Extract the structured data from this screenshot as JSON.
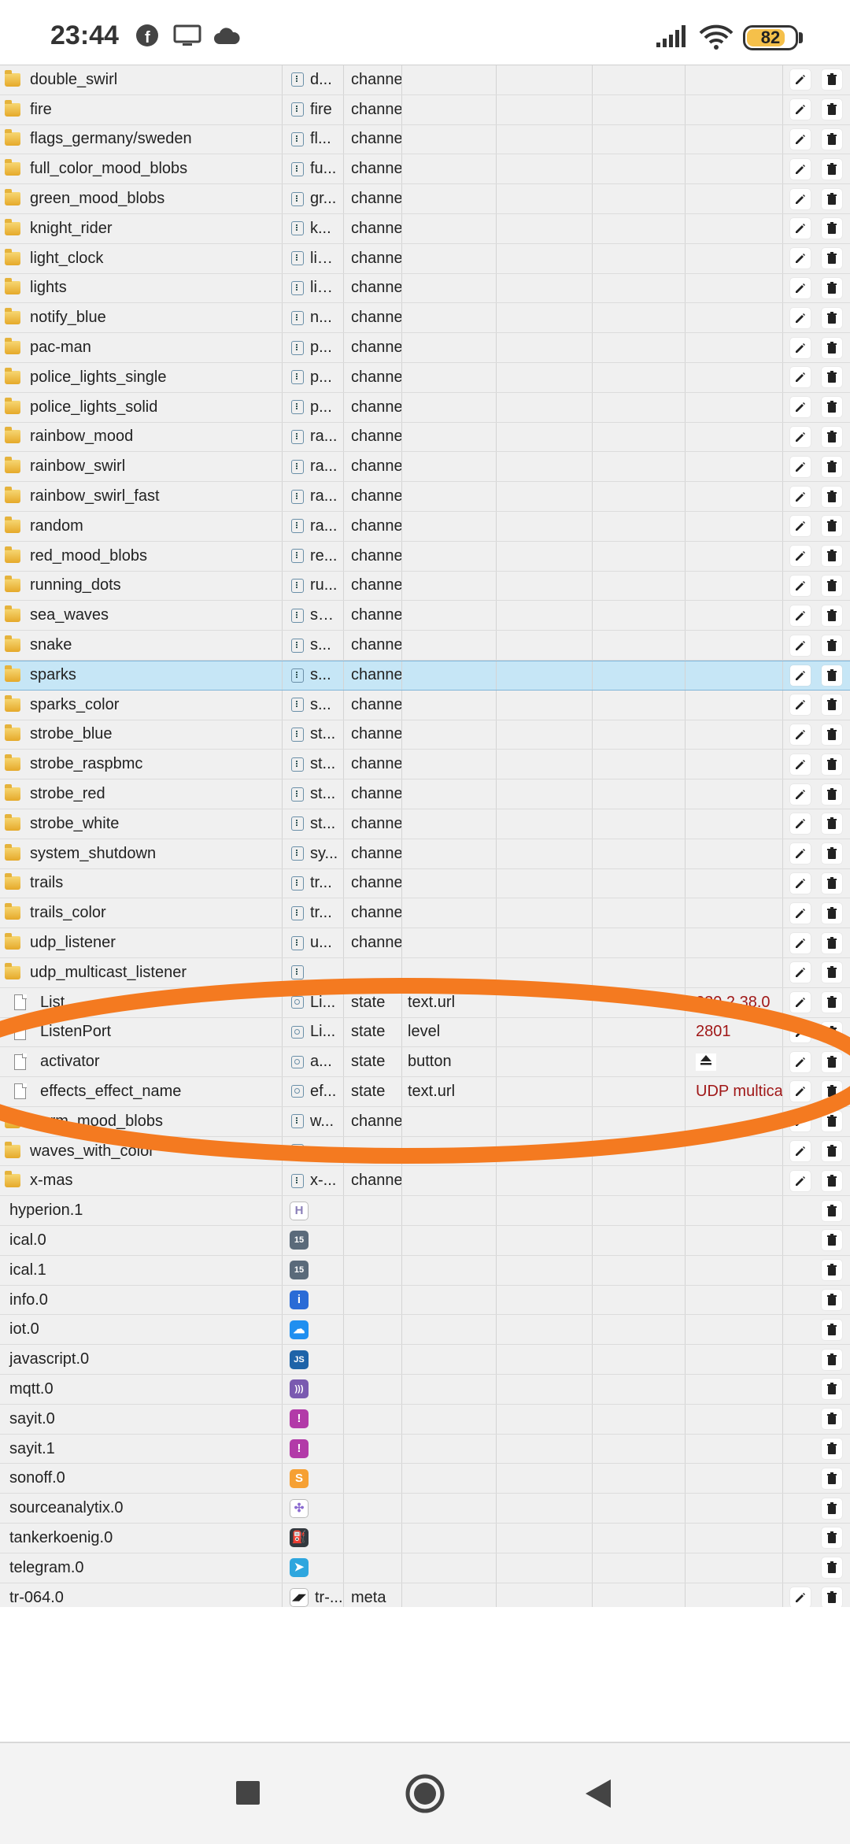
{
  "status_bar": {
    "time": "23:44",
    "icons": [
      "facebook-icon",
      "screen-cast-icon",
      "cloud-icon"
    ],
    "right_icons": [
      "signal-icon",
      "wifi-icon"
    ],
    "battery": "82",
    "battery_level": 0.82
  },
  "rows": [
    {
      "kind": "folder",
      "name": "double_swirl",
      "icon": "obj",
      "type": "d...",
      "role": "channe"
    },
    {
      "kind": "folder",
      "name": "fire",
      "icon": "obj",
      "type": "fire",
      "role": "channe"
    },
    {
      "kind": "folder",
      "name": "flags_germany/sweden",
      "icon": "obj",
      "type": "fl...",
      "role": "channe"
    },
    {
      "kind": "folder",
      "name": "full_color_mood_blobs",
      "icon": "obj",
      "type": "fu...",
      "role": "channe"
    },
    {
      "kind": "folder",
      "name": "green_mood_blobs",
      "icon": "obj",
      "type": "gr...",
      "role": "channe"
    },
    {
      "kind": "folder",
      "name": "knight_rider",
      "icon": "obj",
      "type": "k...",
      "role": "channe"
    },
    {
      "kind": "folder",
      "name": "light_clock",
      "icon": "obj",
      "type": "lig...",
      "role": "channe"
    },
    {
      "kind": "folder",
      "name": "lights",
      "icon": "obj",
      "type": "lig...",
      "role": "channe"
    },
    {
      "kind": "folder",
      "name": "notify_blue",
      "icon": "obj",
      "type": "n...",
      "role": "channe"
    },
    {
      "kind": "folder",
      "name": "pac-man",
      "icon": "obj",
      "type": "p...",
      "role": "channe"
    },
    {
      "kind": "folder",
      "name": "police_lights_single",
      "icon": "obj",
      "type": "p...",
      "role": "channe"
    },
    {
      "kind": "folder",
      "name": "police_lights_solid",
      "icon": "obj",
      "type": "p...",
      "role": "channe"
    },
    {
      "kind": "folder",
      "name": "rainbow_mood",
      "icon": "obj",
      "type": "ra...",
      "role": "channe"
    },
    {
      "kind": "folder",
      "name": "rainbow_swirl",
      "icon": "obj",
      "type": "ra...",
      "role": "channe"
    },
    {
      "kind": "folder",
      "name": "rainbow_swirl_fast",
      "icon": "obj",
      "type": "ra...",
      "role": "channe"
    },
    {
      "kind": "folder",
      "name": "random",
      "icon": "obj",
      "type": "ra...",
      "role": "channe"
    },
    {
      "kind": "folder",
      "name": "red_mood_blobs",
      "icon": "obj",
      "type": "re...",
      "role": "channe"
    },
    {
      "kind": "folder",
      "name": "running_dots",
      "icon": "obj",
      "type": "ru...",
      "role": "channe"
    },
    {
      "kind": "folder",
      "name": "sea_waves",
      "icon": "obj",
      "type": "se...",
      "role": "channe"
    },
    {
      "kind": "folder",
      "name": "snake",
      "icon": "obj",
      "type": "s...",
      "role": "channe"
    },
    {
      "kind": "folder",
      "name": "sparks",
      "icon": "obj",
      "type": "s...",
      "role": "channe",
      "selected": true
    },
    {
      "kind": "folder",
      "name": "sparks_color",
      "icon": "obj",
      "type": "s...",
      "role": "channe"
    },
    {
      "kind": "folder",
      "name": "strobe_blue",
      "icon": "obj",
      "type": "st...",
      "role": "channe"
    },
    {
      "kind": "folder",
      "name": "strobe_raspbmc",
      "icon": "obj",
      "type": "st...",
      "role": "channe"
    },
    {
      "kind": "folder",
      "name": "strobe_red",
      "icon": "obj",
      "type": "st...",
      "role": "channe"
    },
    {
      "kind": "folder",
      "name": "strobe_white",
      "icon": "obj",
      "type": "st...",
      "role": "channe"
    },
    {
      "kind": "folder",
      "name": "system_shutdown",
      "icon": "obj",
      "type": "sy...",
      "role": "channe"
    },
    {
      "kind": "folder",
      "name": "trails",
      "icon": "obj",
      "type": "tr...",
      "role": "channe"
    },
    {
      "kind": "folder",
      "name": "trails_color",
      "icon": "obj",
      "type": "tr...",
      "role": "channe"
    },
    {
      "kind": "folder",
      "name": "udp_listener",
      "icon": "obj",
      "type": "u...",
      "role": "channe"
    },
    {
      "kind": "folder",
      "name": "udp_multicast_listener",
      "icon": "obj",
      "type": "",
      "role": ""
    },
    {
      "kind": "file",
      "name": "List",
      "icon": "state",
      "type": "Li...",
      "role": "state",
      "subrole": "text.url",
      "value": "239.2.38.0"
    },
    {
      "kind": "file",
      "name": "ListenPort",
      "icon": "state",
      "type": "Li...",
      "role": "state",
      "subrole": "level",
      "value": "2801"
    },
    {
      "kind": "file",
      "name": "activator",
      "icon": "state",
      "type": "a...",
      "role": "state",
      "subrole": "button",
      "value": "",
      "eject": true
    },
    {
      "kind": "file",
      "name": "effects_effect_name",
      "icon": "state",
      "type": "ef...",
      "role": "state",
      "subrole": "text.url",
      "value": "UDP multicas"
    },
    {
      "kind": "folder",
      "name": "warm_mood_blobs",
      "icon": "obj",
      "type": "w...",
      "role": "channe"
    },
    {
      "kind": "folder",
      "name": "waves_with_color",
      "icon": "obj",
      "type": "",
      "role": ""
    },
    {
      "kind": "folder",
      "name": "x-mas",
      "icon": "obj",
      "type": "x-...",
      "role": "channe"
    },
    {
      "kind": "adapter",
      "name": "hyperion.1",
      "adapter_icon": "hyperion-icon",
      "symbol": "H",
      "color": "#ffffff",
      "fg": "#8a7fb8"
    },
    {
      "kind": "adapter",
      "name": "ical.0",
      "adapter_icon": "calendar-icon",
      "symbol": "15",
      "color": "#5a6a7a",
      "fg": "#ffffff"
    },
    {
      "kind": "adapter",
      "name": "ical.1",
      "adapter_icon": "calendar-icon",
      "symbol": "15",
      "color": "#5a6a7a",
      "fg": "#ffffff"
    },
    {
      "kind": "adapter",
      "name": "info.0",
      "adapter_icon": "info-icon",
      "symbol": "i",
      "color": "#2a6bd6",
      "fg": "#ffffff"
    },
    {
      "kind": "adapter",
      "name": "iot.0",
      "adapter_icon": "cloud-icon",
      "symbol": "☁",
      "color": "#1f8ff0",
      "fg": "#ffffff"
    },
    {
      "kind": "adapter",
      "name": "javascript.0",
      "adapter_icon": "js-icon",
      "symbol": "JS",
      "color": "#1e63a8",
      "fg": "#ffffff"
    },
    {
      "kind": "adapter",
      "name": "mqtt.0",
      "adapter_icon": "mqtt-icon",
      "symbol": ")))",
      "color": "#7a5ab0",
      "fg": "#ffffff"
    },
    {
      "kind": "adapter",
      "name": "sayit.0",
      "adapter_icon": "sayit-icon",
      "symbol": "!",
      "color": "#b23aa8",
      "fg": "#ffffff"
    },
    {
      "kind": "adapter",
      "name": "sayit.1",
      "adapter_icon": "sayit-icon",
      "symbol": "!",
      "color": "#b23aa8",
      "fg": "#ffffff"
    },
    {
      "kind": "adapter",
      "name": "sonoff.0",
      "adapter_icon": "sonoff-icon",
      "symbol": "S",
      "color": "#f6a033",
      "fg": "#ffffff"
    },
    {
      "kind": "adapter",
      "name": "sourceanalytix.0",
      "adapter_icon": "sourceanalytix-icon",
      "symbol": "✣",
      "color": "#ffffff",
      "fg": "#8a6ad0"
    },
    {
      "kind": "adapter",
      "name": "tankerkoenig.0",
      "adapter_icon": "fuel-icon",
      "symbol": "⛽",
      "color": "#33393f",
      "fg": "#ffffff"
    },
    {
      "kind": "adapter",
      "name": "telegram.0",
      "adapter_icon": "telegram-icon",
      "symbol": "➤",
      "color": "#2ea6de",
      "fg": "#ffffff"
    },
    {
      "kind": "adapter",
      "name": "tr-064.0",
      "adapter_icon": "tr064-icon",
      "symbol": "◢◤",
      "color": "#ffffff",
      "fg": "#222",
      "type": "tr-...",
      "role": "meta",
      "edit": true
    }
  ],
  "annotation": {
    "color": "#f47a20"
  },
  "nav": {
    "icons": [
      "recent-apps-icon",
      "home-icon",
      "back-icon"
    ]
  }
}
